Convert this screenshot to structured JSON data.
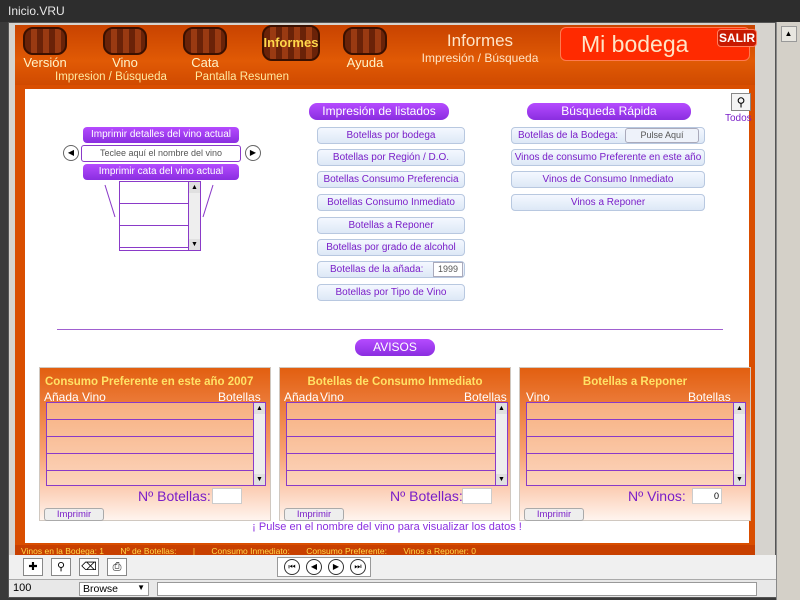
{
  "window": {
    "title": "Inicio.VRU"
  },
  "nav": {
    "items": [
      {
        "label": "Versión"
      },
      {
        "label": "Vino"
      },
      {
        "label": "Cata"
      },
      {
        "label": "Informes"
      },
      {
        "label": "Ayuda"
      }
    ],
    "sub1": "Impresion / Búsqueda",
    "sub2": "Pantalla Resumen"
  },
  "header": {
    "section_title": "Informes",
    "section_subtitle": "Impresión / Búsqueda",
    "app_title": "Mi bodega",
    "exit_label": "SALIR"
  },
  "search": {
    "label": "Todos"
  },
  "wine_panel": {
    "print_details": "Imprimir detalles del vino actual",
    "name_placeholder": "Teclee aquí el nombre del vino",
    "print_tasting": "Imprimir cata del vino actual"
  },
  "print_lists": {
    "title": "Impresión de listados",
    "buttons": [
      "Botellas por bodega",
      "Botellas por Región / D.O.",
      "Botellas Consumo Preferencia",
      "Botellas Consumo Inmediato",
      "Botellas a Reponer",
      "Botellas por grado de alcohol",
      "Botellas de la añada:",
      "Botellas por Tipo de Vino"
    ],
    "year_value": "1999"
  },
  "quick_search": {
    "title": "Búsqueda Rápida",
    "bodega_label": "Botellas de la Bodega:",
    "bodega_button": "Pulse Aquí",
    "buttons": [
      "Vinos de consumo Preferente en este año",
      "Vinos de Consumo Inmediato",
      "Vinos a Reponer"
    ]
  },
  "avisos": {
    "title": "AVISOS",
    "boxes": [
      {
        "title": "Consumo Preferente en este año 2007",
        "col1": "Añada",
        "col2": "Vino",
        "col3": "Botellas",
        "count_label": "Nº Botellas:",
        "count_value": "",
        "print": "Imprimir"
      },
      {
        "title": "Botellas de Consumo Inmediato",
        "col1": "Añada",
        "col2": "Vino",
        "col3": "Botellas",
        "count_label": "Nº Botellas:",
        "count_value": "",
        "print": "Imprimir"
      },
      {
        "title": "Botellas a Reponer",
        "col1": "",
        "col2": "Vino",
        "col3": "Botellas",
        "count_label": "Nº Vinos:",
        "count_value": "0",
        "print": "Imprimir"
      }
    ]
  },
  "footnote": "¡ Pulse en el nombre del vino para visualizar los datos !",
  "status": {
    "items": [
      "Vinos en la Bodega: 1",
      "Nº de Botellas:",
      "|",
      "Consumo Inmediato:",
      "Consumo Preferente:",
      "Vinos a Reponer: 0"
    ]
  },
  "bottom": {
    "zoom": "100",
    "mode": "Browse"
  },
  "colors": {
    "accent": "#d94e00",
    "purple": "#8a2ee0",
    "yellow": "#ffd84a"
  }
}
